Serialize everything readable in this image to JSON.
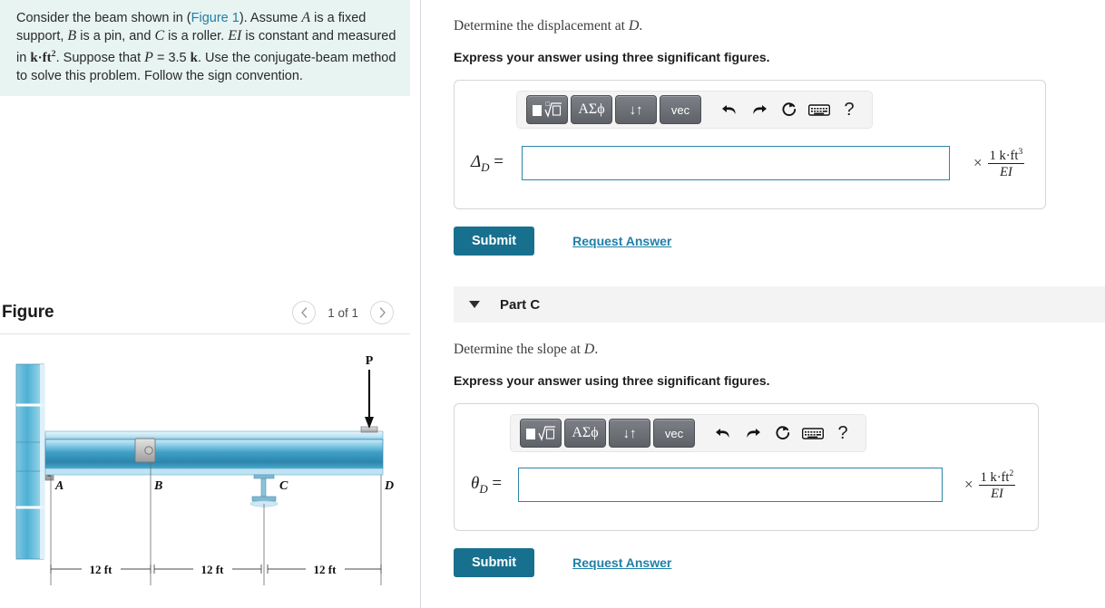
{
  "question": {
    "line_prefix": "Consider the beam shown in (",
    "figure_link": "Figure 1",
    "after_link": "). Assume ",
    "var_A": "A",
    "t1": " is a fixed support, ",
    "var_B": "B",
    "t2": " is a pin, and ",
    "var_C": "C",
    "t3": " is a roller. ",
    "var_EI": "EI",
    "t4": " is constant and measured in ",
    "units_kft2": "k·ft",
    "units_exp": "2",
    "t5": ". Suppose that ",
    "var_P": "P",
    "t6": " = 3.5 ",
    "unit_k": "k",
    "t7": ". Use the conjugate-beam method to solve this problem. Follow the sign convention."
  },
  "figure": {
    "title": "Figure",
    "pager_prev_icon": "chevron-left-icon",
    "pager_next_icon": "chevron-right-icon",
    "count_label": "1 of 1",
    "labels": {
      "A": "A",
      "B": "B",
      "C": "C",
      "D": "D",
      "P": "P",
      "span1": "12 ft",
      "span2": "12 ft",
      "span3": "12 ft"
    },
    "colors": {
      "beam_light": "#bfe3f2",
      "beam_mid": "#3f9fc6",
      "beam_dark": "#1e6f96",
      "support_gray": "#bcbcbc",
      "wall_blue": "#72c2de"
    }
  },
  "part_b": {
    "prompt_text": "Determine the displacement at ",
    "prompt_var": "D",
    "prompt_end": ".",
    "instruction": "Express your answer using three significant figures.",
    "toolbar": {
      "template_label": "template-sqrt",
      "greek_label": "ΑΣϕ",
      "arrows_label": "↓↑",
      "vec_label": "vec",
      "undo_label": "undo-icon",
      "redo_label": "redo-icon",
      "reset_label": "reset-icon",
      "keyboard_label": "keyboard-icon",
      "help_label": "?"
    },
    "answer_label_sym": "Δ",
    "answer_label_sub": "D",
    "answer_label_eq": "=",
    "answer_value": "",
    "unit_times": "×",
    "unit_num": "1 k·ft",
    "unit_num_exp": "3",
    "unit_den": "EI",
    "submit_label": "Submit",
    "request_answer_label": "Request Answer"
  },
  "part_c": {
    "header_title": "Part C",
    "collapse_icon": "triangle-down-icon",
    "prompt_text": "Determine the slope at ",
    "prompt_var": "D",
    "prompt_end": ".",
    "instruction": "Express your answer using three significant figures.",
    "toolbar": {
      "template_label": "template-sqrt",
      "greek_label": "ΑΣϕ",
      "arrows_label": "↓↑",
      "vec_label": "vec",
      "undo_label": "undo-icon",
      "redo_label": "redo-icon",
      "reset_label": "reset-icon",
      "keyboard_label": "keyboard-icon",
      "help_label": "?"
    },
    "answer_label_sym": "θ",
    "answer_label_sub": "D",
    "answer_label_eq": "=",
    "answer_value": "",
    "unit_times": "×",
    "unit_num": "1 k·ft",
    "unit_num_exp": "2",
    "unit_den": "EI",
    "submit_label": "Submit",
    "request_answer_label": "Request Answer"
  },
  "theme": {
    "accent": "#18708f",
    "link": "#1f7fa8",
    "question_bg": "#e8f4f2",
    "input_border": "#2e87a8",
    "panel_border": "#d6d6d6"
  }
}
